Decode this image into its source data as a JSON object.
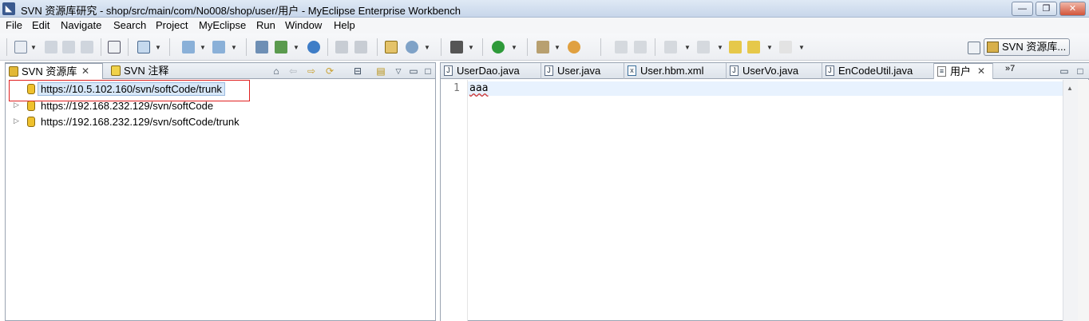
{
  "window": {
    "title": "SVN 资源库研究 - shop/src/main/com/No008/shop/user/用户 - MyEclipse Enterprise Workbench",
    "minimize": "—",
    "maximize": "❐",
    "close": "✕"
  },
  "menu": [
    "File",
    "Edit",
    "Navigate",
    "Search",
    "Project",
    "MyEclipse",
    "Run",
    "Window",
    "Help"
  ],
  "perspective": {
    "label": "SVN 资源库...",
    "open_icon": "open-perspective-icon"
  },
  "left_panel": {
    "tabs": [
      {
        "label": "SVN 资源库",
        "active": true,
        "close": "✕"
      },
      {
        "label": "SVN 注释",
        "active": false
      }
    ],
    "tree": [
      {
        "label": "https://10.5.102.160/svn/softCode/trunk",
        "selected": true
      },
      {
        "label": "https://192.168.232.129/svn/softCode",
        "selected": false
      },
      {
        "label": "https://192.168.232.129/svn/softCode/trunk",
        "selected": false
      }
    ]
  },
  "editor": {
    "tabs": [
      {
        "label": "UserDao.java",
        "icon": "java-file-icon"
      },
      {
        "label": "User.java",
        "icon": "java-file-icon"
      },
      {
        "label": "User.hbm.xml",
        "icon": "xml-file-icon"
      },
      {
        "label": "UserVo.java",
        "icon": "java-file-icon"
      },
      {
        "label": "EnCodeUtil.java",
        "icon": "java-file-icon"
      },
      {
        "label": "用户",
        "icon": "text-file-icon",
        "active": true,
        "close": "✕"
      }
    ],
    "overflow_label": "»7",
    "line_number": "1",
    "code": "aaa"
  },
  "colors": {
    "selection_border": "#e02020",
    "current_line": "#e8f2fe",
    "tree_selection": "#d7e7f8"
  }
}
